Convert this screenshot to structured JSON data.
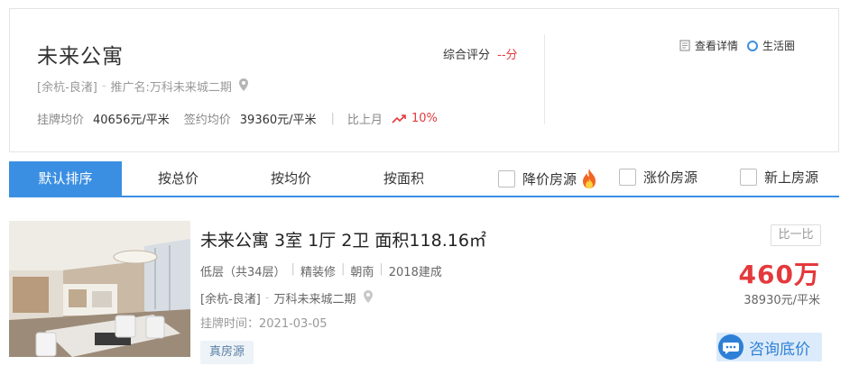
{
  "community": {
    "name": "未来公寓",
    "district": "[余杭-良渚]",
    "promo_name": "推广名:万科未来城二期",
    "listing_avg_label": "挂牌均价",
    "listing_avg_value": "40656元/平米",
    "deal_avg_label": "签约均价",
    "deal_avg_value": "39360元/平米",
    "mom_label": "比上月",
    "mom_value": "10%",
    "score_label": "综合评分",
    "score_value": "--分",
    "detail_link": "查看详情",
    "life_link": "生活圈",
    "icons": [
      "location-pin-icon",
      "trend-up-icon",
      "document-icon",
      "circle-icon"
    ]
  },
  "sort": {
    "tabs": [
      "默认排序",
      "按总价",
      "按均价",
      "按面积"
    ],
    "active_index": 0,
    "filters": [
      "降价房源",
      "涨价房源",
      "新上房源"
    ],
    "accent_color": "#3b8fe2"
  },
  "listing": {
    "title": "未来公寓 3室 1厅 2卫 面积118.16㎡",
    "floor": "低层（共34层）",
    "decoration": "精装修",
    "orientation": "朝南",
    "built": "2018建成",
    "district": "[余杭-良渚]",
    "community": "万科未来城二期",
    "list_time": "挂牌时间：2021-03-05",
    "tag": "真房源",
    "compare": "比一比",
    "total_price": "460万",
    "unit_price": "38930元/平米",
    "consult": "咨询底价",
    "price_color": "#e4393c"
  }
}
